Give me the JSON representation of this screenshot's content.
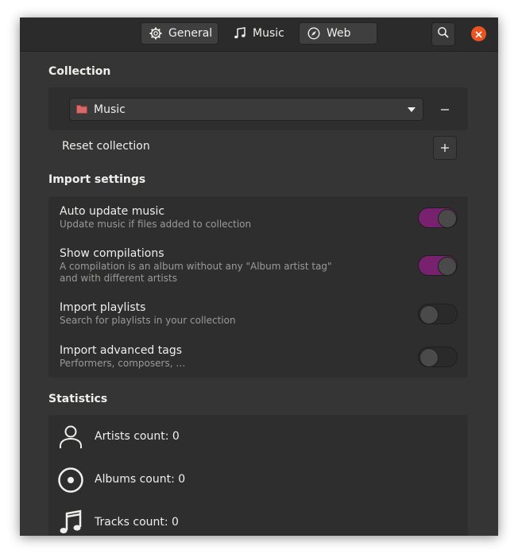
{
  "header": {
    "tabs": [
      {
        "label": "General",
        "icon": "gear-icon"
      },
      {
        "label": "Music",
        "icon": "music-note-icon"
      },
      {
        "label": "Web",
        "icon": "compass-icon"
      }
    ],
    "search_icon": "search-icon",
    "close_icon": "close-icon",
    "accent": "#e95420"
  },
  "collection": {
    "title": "Collection",
    "dropdown_value": "Music",
    "reset_label": "Reset collection"
  },
  "import": {
    "title": "Import settings",
    "toggle_on_color": "#77216f",
    "rows": [
      {
        "label": "Auto update music",
        "sub": "Update music if files added to collection",
        "on": true
      },
      {
        "label": "Show compilations",
        "sub": "A compilation is an album without any \"Album artist tag\"",
        "sub2": "and with different artists",
        "on": true
      },
      {
        "label": "Import playlists",
        "sub": "Search for playlists in your collection",
        "on": false
      },
      {
        "label": "Import advanced tags",
        "sub": "Performers, composers, …",
        "on": false
      }
    ]
  },
  "statistics": {
    "title": "Statistics",
    "items": [
      {
        "label": "Artists count: 0",
        "icon": "person-icon"
      },
      {
        "label": "Albums count: 0",
        "icon": "disc-icon"
      },
      {
        "label": "Tracks count: 0",
        "icon": "music-note-icon"
      }
    ]
  }
}
